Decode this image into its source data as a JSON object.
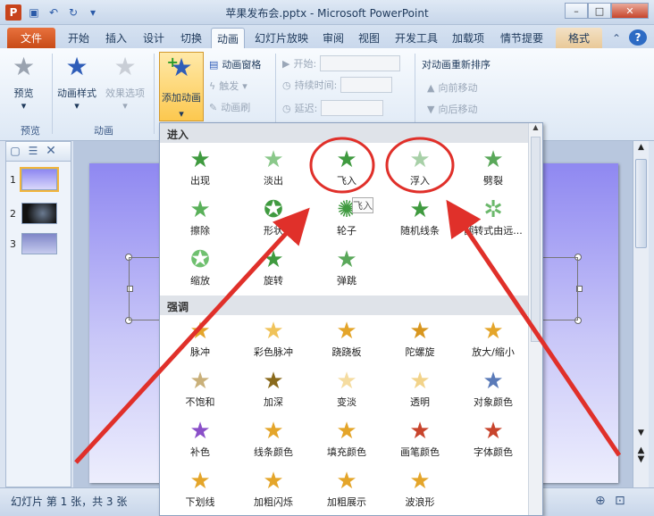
{
  "window": {
    "title": "苹果发布会.pptx - Microsoft PowerPoint",
    "app_icon": "P"
  },
  "tabs": [
    "文件",
    "开始",
    "插入",
    "设计",
    "切换",
    "动画",
    "幻灯片放映",
    "审阅",
    "视图",
    "开发工具",
    "加载项",
    "情节提要",
    "格式"
  ],
  "ribbon": {
    "preview": "预览",
    "preview_group": "预览",
    "anim_style": "动画样式",
    "effect_options": "效果选项",
    "animation_group": "动画",
    "add_animation": "添加动画",
    "anim_pane": "动画窗格",
    "trigger": "触发",
    "anim_painter": "动画刷",
    "start": "开始:",
    "duration": "持续时间:",
    "delay": "延迟:",
    "reorder": "对动画重新排序",
    "move_earlier": "向前移动",
    "move_later": "向后移动"
  },
  "gallery": {
    "enter_header": "进入",
    "emphasis_header": "强调",
    "enter_items": [
      "出现",
      "淡出",
      "飞入",
      "浮入",
      "劈裂",
      "擦除",
      "形状",
      "轮子",
      "随机线条",
      "翻转式由远...",
      "缩放",
      "旋转",
      "弹跳"
    ],
    "emphasis_items": [
      "脉冲",
      "彩色脉冲",
      "跷跷板",
      "陀螺旋",
      "放大/缩小",
      "不饱和",
      "加深",
      "变淡",
      "透明",
      "对象颜色",
      "补色",
      "线条颜色",
      "填充颜色",
      "画笔颜色",
      "字体颜色",
      "下划线",
      "加粗闪烁",
      "加粗展示",
      "波浪形"
    ],
    "tooltip": "飞入"
  },
  "slides": [
    "1",
    "2",
    "3"
  ],
  "status": {
    "text": "幻灯片 第 1 张，共 3 张"
  },
  "colors": {
    "accent_file": "#c84b17",
    "highlight_red": "#e0302a",
    "star_green": "#3f9a3f",
    "star_gold": "#e4a52a"
  }
}
